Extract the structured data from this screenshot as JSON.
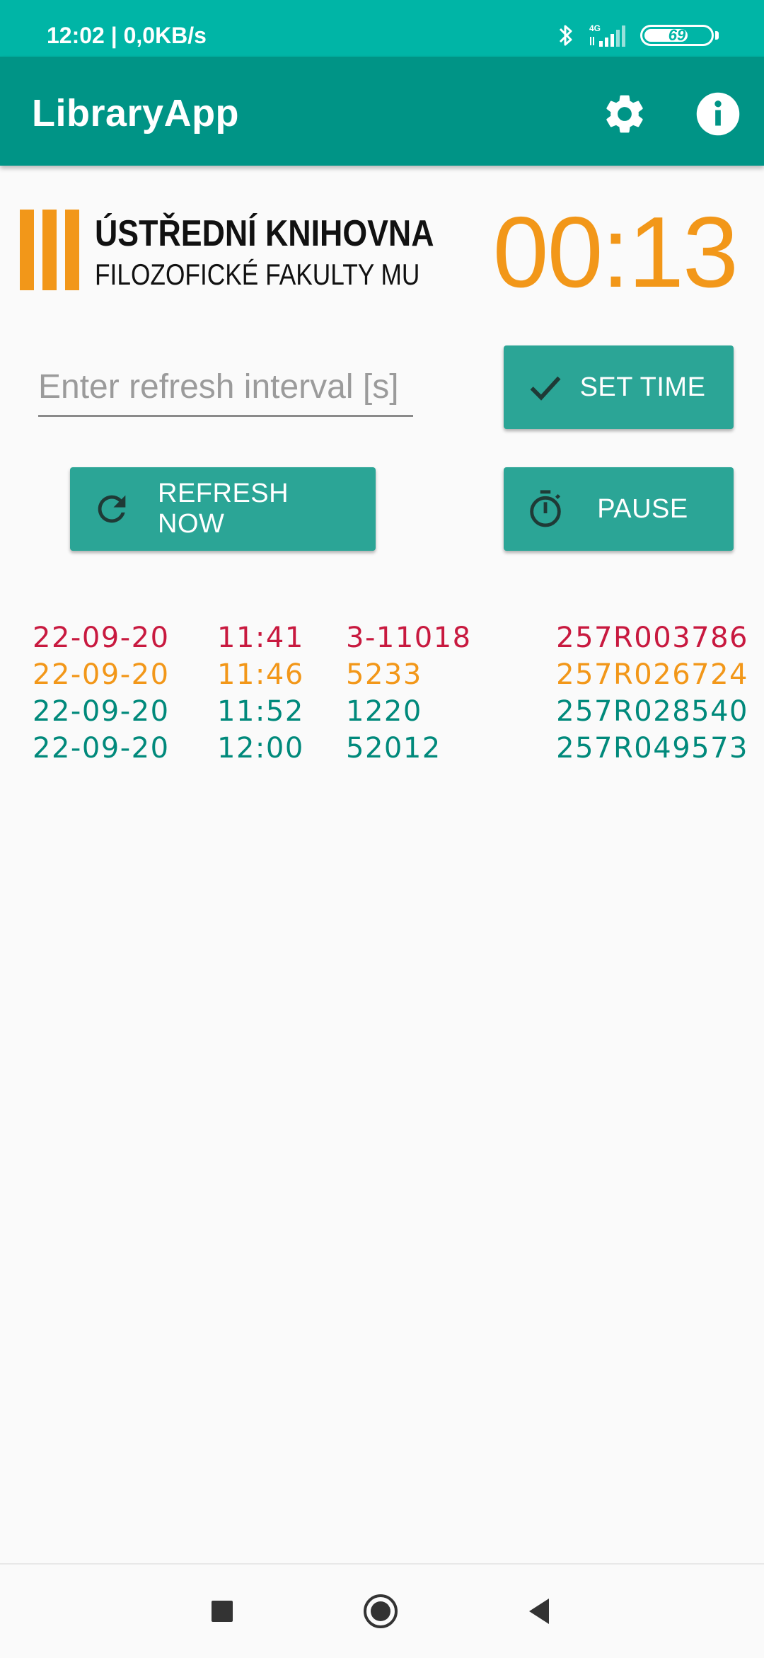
{
  "status_bar": {
    "time": "12:02 | 0,0KB/s",
    "network": "4G",
    "battery": "69"
  },
  "app_bar": {
    "title": "LibraryApp",
    "icons": [
      "gear-icon",
      "info-icon"
    ]
  },
  "logo": {
    "line1": "ÚSTŘEDNÍ KNIHOVNA",
    "line2": "FILOZOFICKÉ FAKULTY MU",
    "color": "#f29719"
  },
  "timer": {
    "value": "00:13",
    "color": "#f29719"
  },
  "interval_input": {
    "value": "",
    "placeholder": "Enter refresh interval [s]"
  },
  "buttons": {
    "set_time": "SET TIME",
    "refresh_now": "REFRESH NOW",
    "pause": "PAUSE"
  },
  "log": [
    {
      "date": "22-09-20",
      "time": "11:41",
      "code": "3-11018",
      "id": "257R003786",
      "color": "#c8193f"
    },
    {
      "date": "22-09-20",
      "time": "11:46",
      "code": "5233",
      "id": "257R026724",
      "color": "#f29719"
    },
    {
      "date": "22-09-20",
      "time": "11:52",
      "code": "1220",
      "id": "257R028540",
      "color": "#00897b"
    },
    {
      "date": "22-09-20",
      "time": "12:00",
      "code": "52012",
      "id": "257R049573",
      "color": "#00897b"
    }
  ],
  "theme": {
    "status_bar": "#00b5a6",
    "app_bar": "#009486",
    "button": "#2ba596"
  },
  "nav": [
    "recent-apps-icon",
    "home-icon",
    "back-icon"
  ]
}
